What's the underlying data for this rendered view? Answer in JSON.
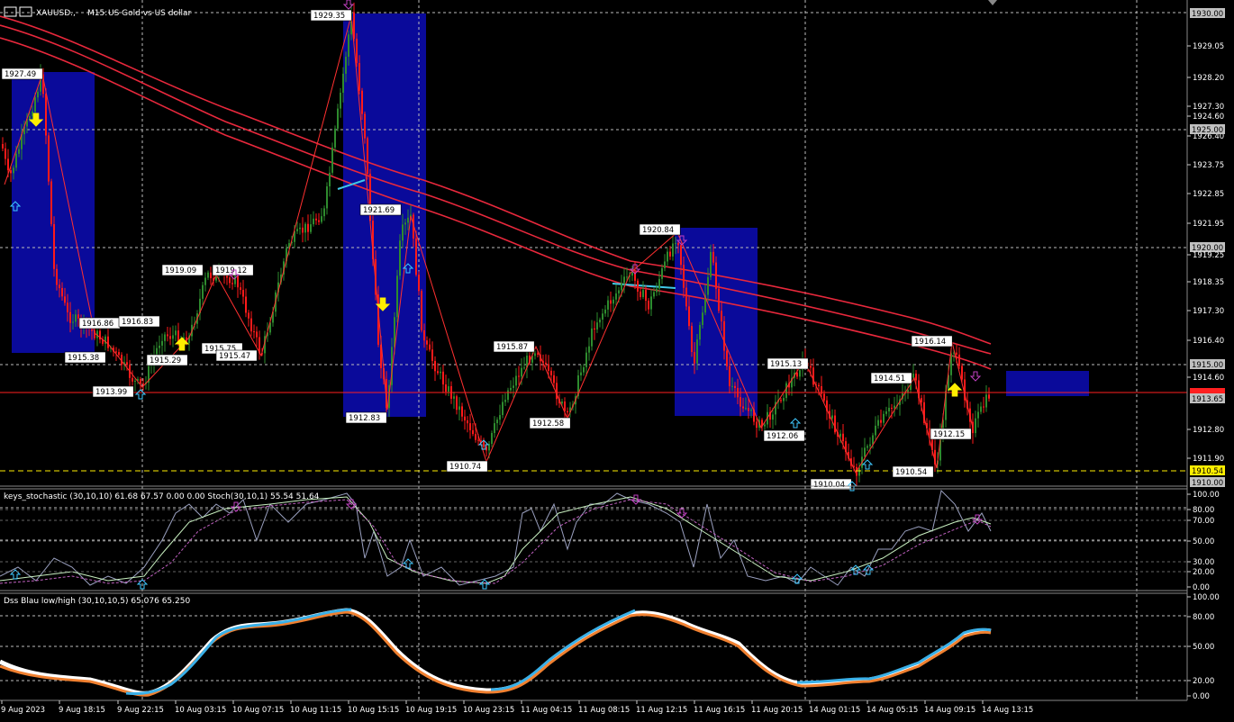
{
  "app": {
    "symbol": "XAUUSD.,",
    "timeframe": "M15:",
    "description": "US Gold vs US dollar",
    "icon": "chart-window-icon"
  },
  "colors": {
    "background": "#000000",
    "axis_text": "#ffffff",
    "grid": "#c8c8c8",
    "bull": "#2e8b2e",
    "bear": "#ff1a1a",
    "ma": "#e8283c",
    "zone": "#0a0a9a",
    "zigzag": "#ff3030",
    "arrow_up_cyan": "#3ec8ff",
    "arrow_down_magenta": "#c040c0",
    "arrow_yellow": "#ffee00",
    "level_yellow": "#ffee00",
    "level_red": "#ff2020",
    "dss_blue": "#3ab0e8",
    "dss_orange": "#f08030"
  },
  "main_chart": {
    "price_labels": [
      "1930.00",
      "1929.05",
      "1928.20",
      "1927.30",
      "1926.40",
      "1925.00",
      "1924.60",
      "1923.75",
      "1922.85",
      "1921.95",
      "1920.00",
      "1919.25",
      "1918.35",
      "1917.30",
      "1916.40",
      "1915.00",
      "1914.60",
      "1913.65",
      "1912.80",
      "1911.90",
      "1910.54",
      "1910.00"
    ],
    "current_price": "1913.65",
    "level_yellow": "1910.54",
    "swing_labels": [
      {
        "text": "1927.49",
        "anchor": "high"
      },
      {
        "text": "1929.35",
        "anchor": "high"
      },
      {
        "text": "1921.69",
        "anchor": "high"
      },
      {
        "text": "1920.84",
        "anchor": "high"
      },
      {
        "text": "1919.09",
        "anchor": "high"
      },
      {
        "text": "1919.12",
        "anchor": "high"
      },
      {
        "text": "1916.86",
        "anchor": "high"
      },
      {
        "text": "1916.83",
        "anchor": "high"
      },
      {
        "text": "1915.38",
        "anchor": "low"
      },
      {
        "text": "1915.29",
        "anchor": "low"
      },
      {
        "text": "1915.75",
        "anchor": "low"
      },
      {
        "text": "1915.47",
        "anchor": "low"
      },
      {
        "text": "1913.99",
        "anchor": "low"
      },
      {
        "text": "1912.83",
        "anchor": "low"
      },
      {
        "text": "1915.87",
        "anchor": "high"
      },
      {
        "text": "1912.58",
        "anchor": "low"
      },
      {
        "text": "1910.74",
        "anchor": "low"
      },
      {
        "text": "1915.13",
        "anchor": "high"
      },
      {
        "text": "1912.06",
        "anchor": "low"
      },
      {
        "text": "1914.51",
        "anchor": "high"
      },
      {
        "text": "1916.14",
        "anchor": "high"
      },
      {
        "text": "1912.15",
        "anchor": "low"
      },
      {
        "text": "1910.54",
        "anchor": "low"
      },
      {
        "text": "1910.04",
        "anchor": "low"
      }
    ]
  },
  "stoch_panel": {
    "title": "keys_stochastic (30,10,10) 61.68 67.57 0.00 0.00 Stoch(30,10,1) 55.54 51.64",
    "levels": [
      "100.00",
      "80.00",
      "70.00",
      "50.00",
      "30.00",
      "20.00",
      "0.00"
    ]
  },
  "dss_panel": {
    "title": "Dss Blau low/high (30,10,10,5) 65.076 65.250",
    "levels": [
      "100.00",
      "80.00",
      "50.00",
      "20.00",
      "0.00"
    ]
  },
  "time_axis": [
    "9 Aug 2023",
    "9 Aug 18:15",
    "9 Aug 22:15",
    "10 Aug 03:15",
    "10 Aug 07:15",
    "10 Aug 11:15",
    "10 Aug 15:15",
    "10 Aug 19:15",
    "10 Aug 23:15",
    "11 Aug 04:15",
    "11 Aug 08:15",
    "11 Aug 12:15",
    "11 Aug 16:15",
    "11 Aug 20:15",
    "14 Aug 01:15",
    "14 Aug 05:15",
    "14 Aug 09:15",
    "14 Aug 13:15"
  ]
}
